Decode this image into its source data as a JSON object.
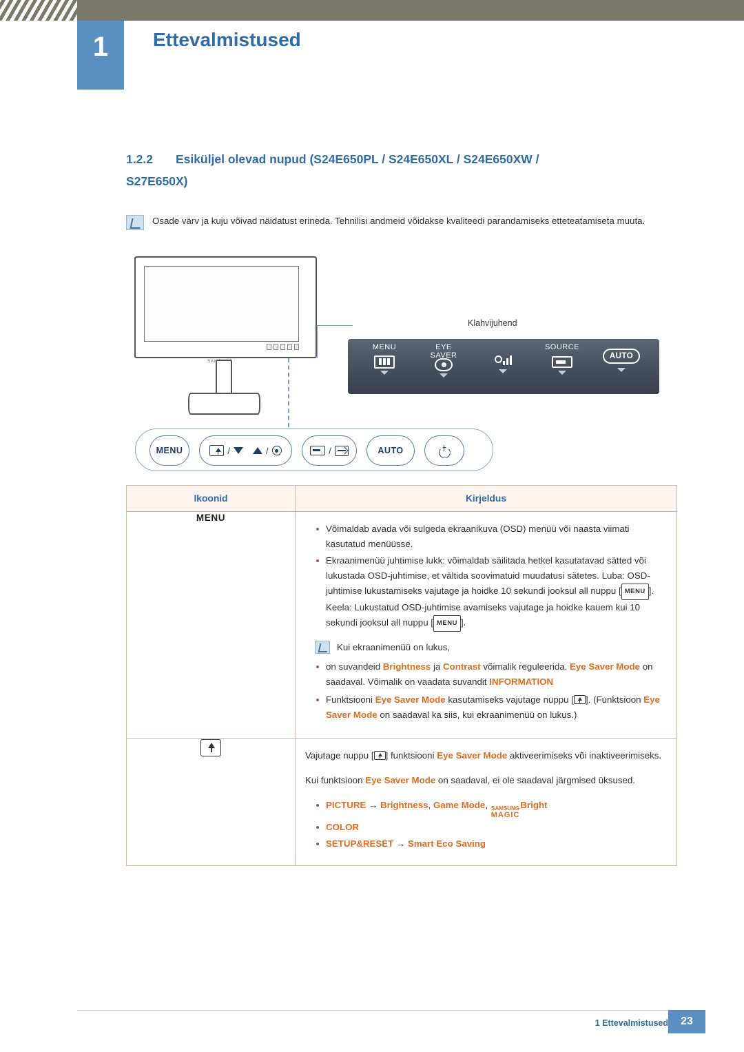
{
  "header": {
    "chapter_number": "1",
    "chapter_title": "Ettevalmistused"
  },
  "section": {
    "number": "1.2.2",
    "title_line1": "Esiküljel olevad nupud (S24E650PL / S24E650XL / S24E650XW /",
    "title_line2": "S27E650X)"
  },
  "note": {
    "text": "Osade värv ja kuju võivad näidatust erineda. Tehnilisi andmeid võidakse kvaliteedi parandamiseks etteteatamiseta muuta."
  },
  "illustration": {
    "monitor_brand": "SAMSUNG",
    "keyguide_label": "Klahvijuhend",
    "keyguide_items": [
      {
        "label": "MENU",
        "icon": "menu-icon"
      },
      {
        "label_line1": "EYE",
        "label_line2": "SAVER",
        "icon": "eye-saver-icon"
      },
      {
        "label": "",
        "icon": "brightness-icon"
      },
      {
        "label": "SOURCE",
        "icon": "source-icon"
      },
      {
        "label": "",
        "icon": "auto-icon",
        "text": "AUTO"
      }
    ],
    "buttons": [
      {
        "name": "menu-button",
        "text": "MENU"
      },
      {
        "name": "eye-saver-down-button",
        "text": ""
      },
      {
        "name": "source-exit-button",
        "text": ""
      },
      {
        "name": "auto-button",
        "text": "AUTO"
      },
      {
        "name": "power-button",
        "text": ""
      }
    ]
  },
  "table": {
    "headers": [
      "Ikoonid",
      "Kirjeldus"
    ],
    "rows": [
      {
        "icon_label": "MENU",
        "bullets": [
          "Võimaldab avada või sulgeda ekraanikuva (OSD) menüü või naasta viimati kasutatud menüüsse.",
          "Ekraanimenüü juhtimise lukk: võimaldab säilitada hetkel kasutatavad sätted või lukustada OSD-juhtimise, et vältida soovimatuid muudatusi sätetes. Luba: OSD-juhtimise lukustamiseks vajutage ja hoidke 10 sekundi jooksul all nuppu [MENU]. Keela: Lukustatud OSD-juhtimise avamiseks vajutage ja hoidke kauem kui 10 sekundi jooksul all nuppu [MENU]."
        ],
        "subnote_intro": "Kui ekraanimenüü on lukus,",
        "subnote_bullets": [
          {
            "prefix": "on suvandeid ",
            "k1": "Brightness",
            "mid": " ja ",
            "k2": "Contrast",
            "mid2": " võimalik reguleerida. ",
            "k3": "Eye Saver Mode",
            "tail": " on saadaval. Võimalik on vaadata suvandit ",
            "k4": "INFORMATION"
          },
          {
            "prefix": "Funktsiooni ",
            "k1": "Eye Saver Mode",
            "mid": " kasutamiseks vajutage nuppu [",
            "k2": "]. (Funktsioon ",
            "k3": "Eye Saver Mode",
            "tail": " on saadaval ka siis, kui ekraanimenüü on lukus.)"
          }
        ]
      },
      {
        "icon_label": "",
        "para1_a": "Vajutage nuppu [",
        "para1_b": "] funktsiooni ",
        "para1_key": "Eye Saver Mode",
        "para1_c": " aktiveerimiseks või inaktiveerimiseks.",
        "para2_a": "Kui funktsioon ",
        "para2_key": "Eye Saver Mode",
        "para2_b": " on saadaval, ei ole saadaval järgmised üksused.",
        "list": [
          {
            "k1": "PICTURE",
            "arrow": "→",
            "k2": "Brightness",
            "sep": ", ",
            "k3": "Game Mode",
            "sep2": ", ",
            "magic_top": "SAMSUNG",
            "magic_bottom": "MAGIC",
            "k4": "Bright"
          },
          {
            "k1": "COLOR"
          },
          {
            "k1": "SETUP&RESET",
            "arrow": "→",
            "k2": "Smart Eco Saving"
          }
        ]
      }
    ]
  },
  "footer": {
    "text": "1 Ettevalmistused",
    "page": "23"
  },
  "colors": {
    "accent_blue": "#2e6ba8",
    "chapter_blue": "#5a8fc2",
    "header_olive": "#7b7a6a",
    "orange": "#e06c1f",
    "table_border": "#d8b6a0"
  }
}
